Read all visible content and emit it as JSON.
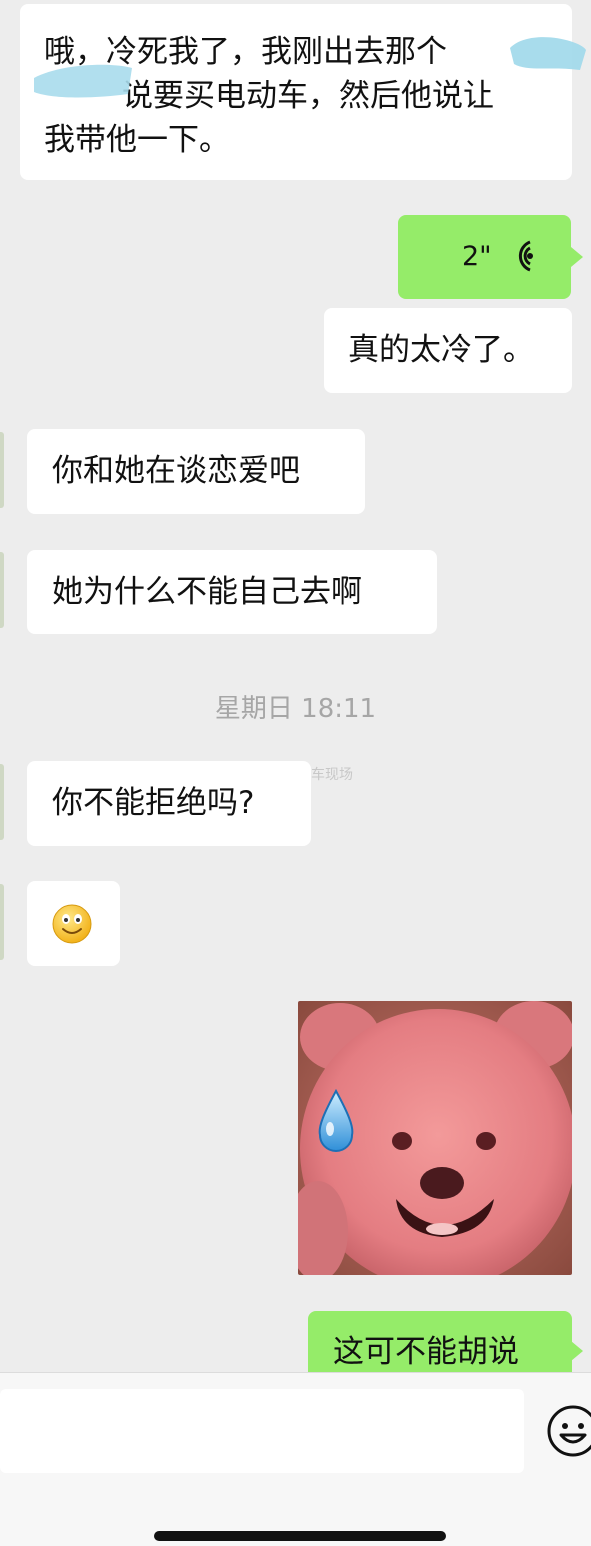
{
  "messages": [
    {
      "side": "left",
      "text_lines": [
        "哦，冷死我了，我刚出去那个",
        "说要买电动车，然后他说让",
        "我带他一下。"
      ]
    },
    {
      "side": "right",
      "type": "voice",
      "duration": "2\""
    },
    {
      "side": "right",
      "text": "真的太冷了。"
    },
    {
      "side": "left",
      "text": "你和她在谈恋爱吧"
    },
    {
      "side": "left",
      "text": "她为什么不能自己去啊"
    },
    {
      "side": "left",
      "text": "你不能拒绝吗?"
    },
    {
      "side": "left",
      "type": "emoji",
      "emoji": "smiley-emoji"
    },
    {
      "side": "right",
      "type": "sticker",
      "sticker": "pink-bear-sweat-sticker"
    },
    {
      "side": "right",
      "text": "这可不能胡说"
    }
  ],
  "timestamp": "星期日 18:11",
  "watermark": "@车现撞车现场",
  "input_bar": {
    "emoji_icon": "emoji-icon"
  },
  "colors": {
    "bg": "#ededed",
    "green_bubble": "#95ec69",
    "white_bubble": "#ffffff"
  }
}
